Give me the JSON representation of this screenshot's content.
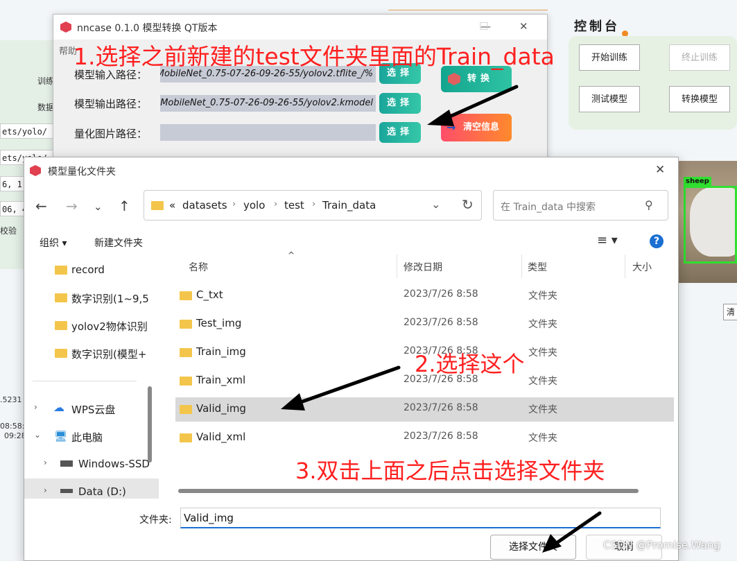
{
  "background": {
    "left_labels": [
      "训练",
      "数据"
    ],
    "code_lines": [
      "ets/yolo/",
      "ets/yolo/",
      "6, 1",
      "06, 4"
    ],
    "check_label": "校验",
    "numbers": [
      ".5231",
      "08:58:0",
      "09:28"
    ],
    "control_title": "控制台",
    "buttons": {
      "start_train": "开始训练",
      "stop_train": "终止训练",
      "test_model": "测试模型",
      "convert_model": "转换模型"
    },
    "detection_label": "sheep",
    "clear_button": "清"
  },
  "nncase": {
    "title": "nncase 0.1.0 模型转换 QT版本",
    "menu": "帮助",
    "input_label": "模型输入路径：",
    "input_value": "%/_MobileNet_0.75-07-26-09-26-55/yolov2.tflite",
    "output_label": "模型输出路径：",
    "output_value": "MobileNet_0.75-07-26-09-26-55/yolov2.kmodel",
    "quant_label": "量化图片路径：",
    "quant_value": "",
    "select_label": "选择",
    "convert_label": "转换",
    "clear_label": "清空信息"
  },
  "dialog": {
    "title": "模型量化文件夹",
    "breadcrumb": [
      "«",
      "datasets",
      "yolo",
      "test",
      "Train_data"
    ],
    "search_placeholder": "在 Train_data 中搜索",
    "organize": "组织 ▾",
    "new_folder": "新建文件夹",
    "nav_items": [
      {
        "label": "record",
        "type": "folder"
      },
      {
        "label": "数字识别(1~9,5",
        "type": "folder"
      },
      {
        "label": "yolov2物体识别",
        "type": "folder"
      },
      {
        "label": "数字识别(模型+",
        "type": "folder"
      },
      {
        "label": "WPS云盘",
        "type": "cloud"
      },
      {
        "label": "此电脑",
        "type": "pc"
      },
      {
        "label": "Windows-SSD",
        "type": "drive"
      },
      {
        "label": "Data (D:)",
        "type": "drive"
      }
    ],
    "columns": [
      "名称",
      "修改日期",
      "类型",
      "大小"
    ],
    "files": [
      {
        "name": "C_txt",
        "date": "2023/7/26 8:58",
        "type": "文件夹"
      },
      {
        "name": "Test_img",
        "date": "2023/7/26 8:58",
        "type": "文件夹"
      },
      {
        "name": "Train_img",
        "date": "2023/7/26 8:58",
        "type": "文件夹"
      },
      {
        "name": "Train_xml",
        "date": "2023/7/26 8:58",
        "type": "文件夹"
      },
      {
        "name": "Valid_img",
        "date": "2023/7/26 8:58",
        "type": "文件夹"
      },
      {
        "name": "Valid_xml",
        "date": "2023/7/26 8:58",
        "type": "文件夹"
      }
    ],
    "selected_index": 4,
    "folder_label": "文件夹:",
    "folder_value": "Valid_img",
    "select_button": "选择文件夹",
    "cancel_button": "取消"
  },
  "annotations": {
    "step1": "1.选择之前新建的test文件夹里面的Train_data",
    "step2": "2.选择这个",
    "step3": "3.双击上面之后点击选择文件夹",
    "color": "#ff2020"
  },
  "watermark": "CSDN @Promise.Wang"
}
